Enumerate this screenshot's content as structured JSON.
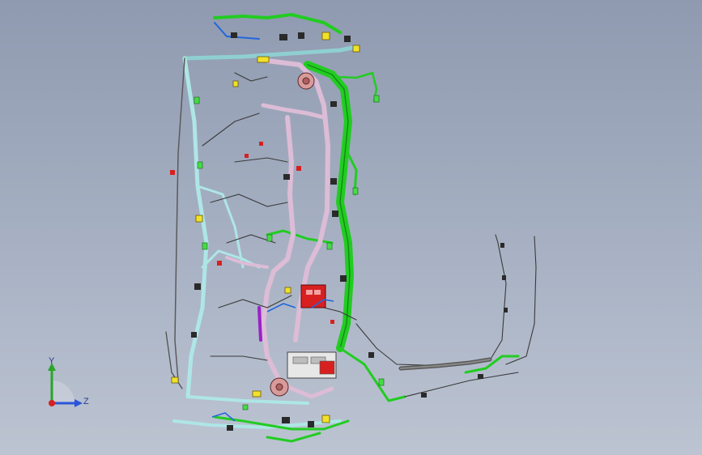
{
  "viewport": {
    "background_top": "#8f9ab0",
    "background_bottom": "#bcc4d2"
  },
  "colors": {
    "harness_green": "#22cc22",
    "harness_green_dark": "#138a13",
    "harness_cyan": "#aee6e6",
    "harness_pink": "#dcbcd6",
    "wire_dark": "#3a3a3a",
    "wire_blue": "#2266dd",
    "connector_yellow": "#f2e12a",
    "connector_red": "#d82020",
    "connector_purple": "#9a20c8"
  },
  "triad": {
    "y_label": "Y",
    "z_label": "Z",
    "y_color": "#2aa52a",
    "z_color": "#2a55d8",
    "x_color": "#d82020"
  }
}
